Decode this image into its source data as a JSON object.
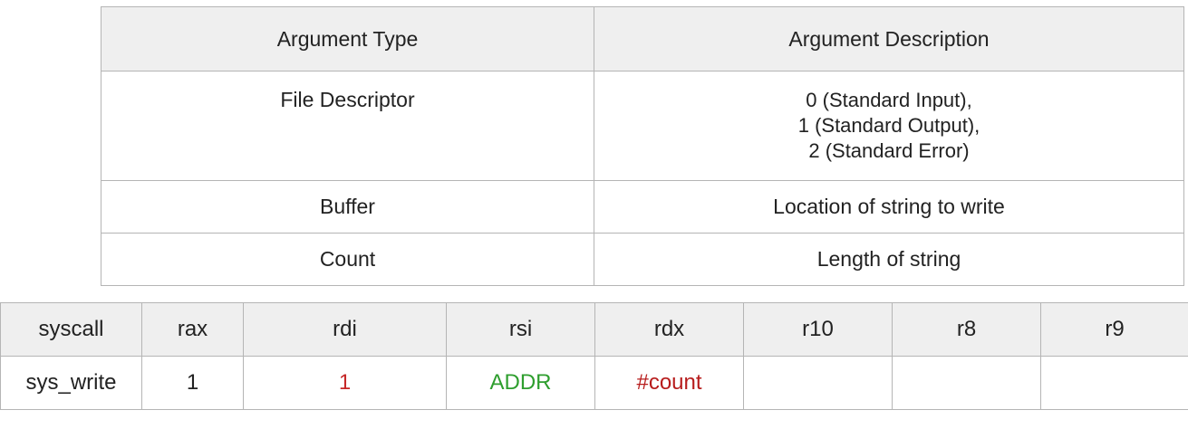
{
  "argument_table": {
    "headers": [
      "Argument Type",
      "Argument Description"
    ],
    "rows": [
      {
        "type": "File Descriptor",
        "description_lines": [
          "0 (Standard Input),",
          "1 (Standard Output),",
          "2 (Standard Error)"
        ]
      },
      {
        "type": "Buffer",
        "description_lines": [
          "Location of string to write"
        ]
      },
      {
        "type": "Count",
        "description_lines": [
          "Length of string"
        ]
      }
    ]
  },
  "register_table": {
    "headers": [
      "syscall",
      "rax",
      "rdi",
      "rsi",
      "rdx",
      "r10",
      "r8",
      "r9"
    ],
    "row": {
      "syscall": "sys_write",
      "rax": "1",
      "rdi": "1",
      "rsi": "ADDR",
      "rdx": "#count",
      "r10": "",
      "r8": "",
      "r9": ""
    },
    "value_colors": {
      "rdi": "#c62828",
      "rsi": "#2e9e2e",
      "rdx": "#b71c1c"
    }
  }
}
